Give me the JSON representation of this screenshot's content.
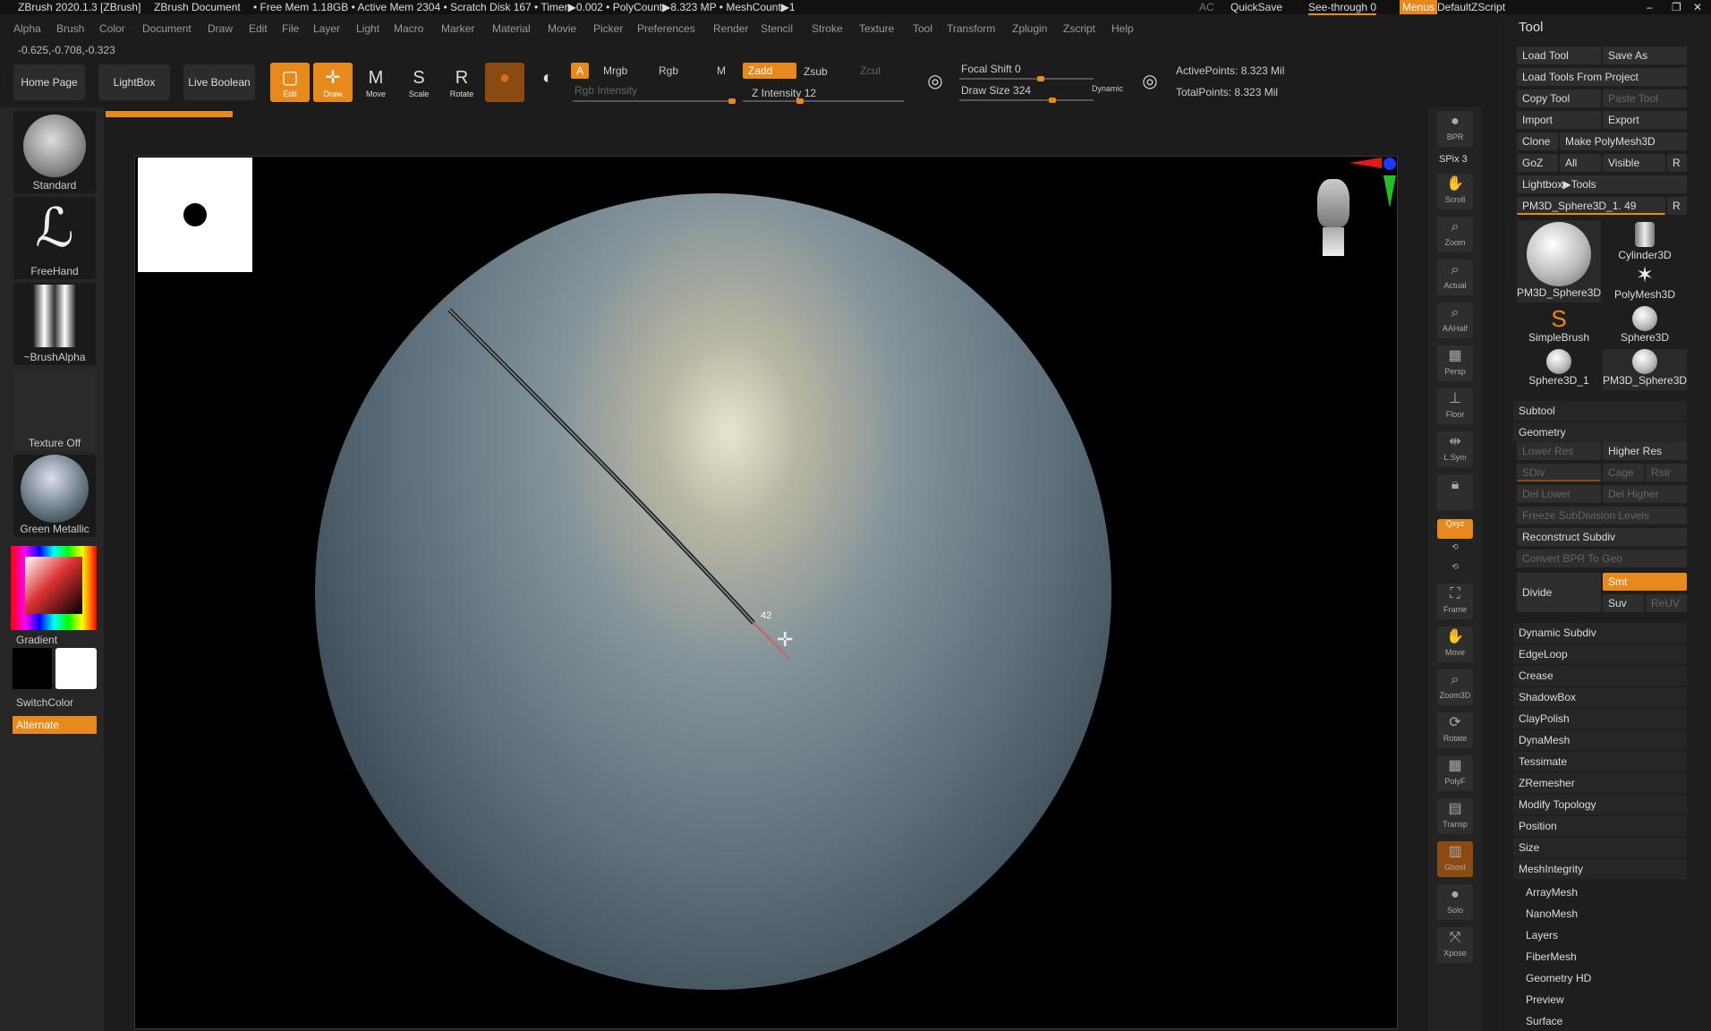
{
  "titlebar": {
    "app": "ZBrush 2020.1.3 [ZBrush]",
    "document": "ZBrush Document",
    "stats": "• Free Mem 1.18GB • Active Mem 2304 • Scratch Disk 167 • Timer▶0.002 • PolyCount▶8.323 MP • MeshCount▶1",
    "ac": "AC",
    "quicksave": "QuickSave",
    "seethrough": "See-through  0",
    "menus": "Menus",
    "zscript": "DefaultZScript"
  },
  "menubar": [
    "Alpha",
    "Brush",
    "Color",
    "Document",
    "Draw",
    "Edit",
    "File",
    "Layer",
    "Light",
    "Macro",
    "Marker",
    "Material",
    "Movie",
    "Picker",
    "Preferences",
    "Render",
    "Stencil",
    "Stroke",
    "Texture",
    "Tool",
    "Transform",
    "Zplugin",
    "Zscript",
    "Help"
  ],
  "coords": "-0.625,-0.708,-0.323",
  "toolbar": {
    "home": "Home Page",
    "lightbox": "LightBox",
    "liveboolean": "Live Boolean",
    "edit": "Edit",
    "draw": "Draw",
    "move": "Move",
    "scale": "Scale",
    "rotate": "Rotate",
    "a": "A",
    "mrgb": "Mrgb",
    "rgb": "Rgb",
    "m": "M",
    "zadd": "Zadd",
    "zsub": "Zsub",
    "zcut": "Zcut",
    "rgb_intensity": "Rgb Intensity",
    "z_intensity": "Z Intensity 12",
    "focal_shift": "Focal Shift 0",
    "draw_size": "Draw Size 324",
    "dynamic": "Dynamic",
    "active_points": "ActivePoints: 8.323 Mil",
    "total_points": "TotalPoints: 8.323 Mil"
  },
  "leftshelf": {
    "brush": "Standard",
    "stroke": "FreeHand",
    "alpha": "~BrushAlpha",
    "texture": "Texture Off",
    "material": "Green Metallic",
    "gradient": "Gradient",
    "switchcolor": "SwitchColor",
    "alternate": "Alternate"
  },
  "viewport": {
    "stroke_value": "42"
  },
  "rightstrip": [
    "BPR",
    "SPix 3",
    "Scroll",
    "Zoom",
    "Actual",
    "AAHalf",
    "Persp",
    "Floor",
    "L.Sym",
    "Local",
    "Qxyz",
    "",
    "",
    "Frame",
    "Move",
    "Zoom3D",
    "Rotate",
    "PolyF",
    "Transp",
    "Ghost",
    "Solo",
    "Xpose"
  ],
  "toolpanel": {
    "title": "Tool",
    "load_tool": "Load Tool",
    "save_as": "Save As",
    "load_from_project": "Load Tools From Project",
    "copy_tool": "Copy Tool",
    "paste_tool": "Paste Tool",
    "import": "Import",
    "export": "Export",
    "clone": "Clone",
    "make_polymesh": "Make PolyMesh3D",
    "goz": "GoZ",
    "all": "All",
    "visible": "Visible",
    "r": "R",
    "lightbox_tools": "Lightbox▶Tools",
    "current_tool": "PM3D_Sphere3D_1. 49",
    "tools": [
      "PM3D_Sphere3D",
      "Cylinder3D",
      "PolyMesh3D",
      "SimpleBrush",
      "Sphere3D",
      "Sphere3D_1",
      "PM3D_Sphere3D"
    ],
    "subtool": "Subtool",
    "geometry": "Geometry",
    "lower_res": "Lower Res",
    "higher_res": "Higher Res",
    "sdiv": "SDiv",
    "cage": "Cage",
    "rstr": "Rstr",
    "del_lower": "Del Lower",
    "del_higher": "Del Higher",
    "freeze": "Freeze SubDivision Levels",
    "reconstruct": "Reconstruct Subdiv",
    "convert_bpr": "Convert BPR To Geo",
    "divide": "Divide",
    "smt": "Smt",
    "suv": "Suv",
    "reuv": "ReUV",
    "geometry_items": [
      "Dynamic Subdiv",
      "EdgeLoop",
      "Crease",
      "ShadowBox",
      "ClayPolish",
      "DynaMesh",
      "Tessimate",
      "ZRemesher",
      "Modify Topology",
      "Position",
      "Size",
      "MeshIntegrity"
    ],
    "sections": [
      "ArrayMesh",
      "NanoMesh",
      "Layers",
      "FiberMesh",
      "Geometry HD",
      "Preview",
      "Surface"
    ]
  },
  "colors": {
    "accent": "#e8891c",
    "panel": "#1e1e1e",
    "viewport": "#000000"
  }
}
